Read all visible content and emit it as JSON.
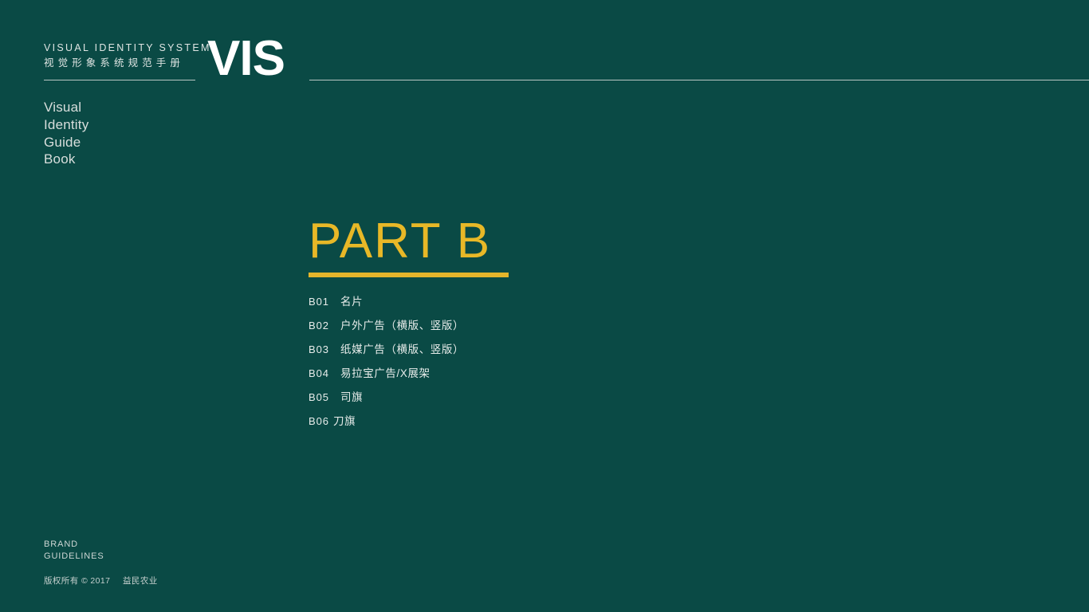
{
  "theme": {
    "background": "#0a4a45",
    "accent_gold": "#e8b827",
    "text_light": "#e7ecea",
    "rule": "#b9c6c3"
  },
  "header": {
    "title_en": "VISUAL  IDENTITY  SYSTEM",
    "title_cn": "视觉形象系统规范手册",
    "logotype": "VIS"
  },
  "sidebar": {
    "wordmark": [
      "Visual",
      "Identity",
      "Guide",
      "Book"
    ]
  },
  "main": {
    "part_title": "PART  B",
    "contents": [
      {
        "code": "B01",
        "label": "名片"
      },
      {
        "code": "B02",
        "label": "户外广告（横版、竖版）"
      },
      {
        "code": "B03",
        "label": "纸媒广告（横版、竖版）"
      },
      {
        "code": "B04",
        "label": "易拉宝广告/X展架"
      },
      {
        "code": "B05",
        "label": "司旗"
      },
      {
        "code": "B06",
        "label": "刀旗"
      }
    ]
  },
  "footer": {
    "brand_line1": "BRAND",
    "brand_line2": "GUIDELINES",
    "copyright_prefix": "版权所有",
    "copyright_symbol": "©",
    "copyright_year": "2017",
    "copyright_owner": "益民农业"
  }
}
